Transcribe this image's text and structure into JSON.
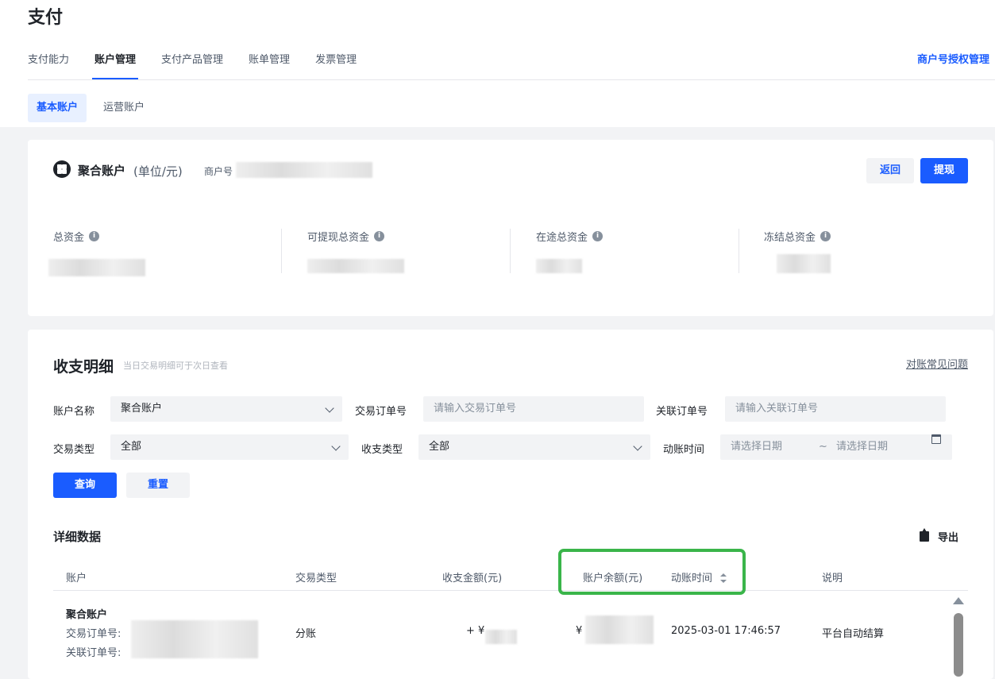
{
  "page_title": "支付",
  "tabs": [
    {
      "label": "支付能力",
      "active": false
    },
    {
      "label": "账户管理",
      "active": true
    },
    {
      "label": "支付产品管理",
      "active": false
    },
    {
      "label": "账单管理",
      "active": false
    },
    {
      "label": "发票管理",
      "active": false
    }
  ],
  "auth_link": "商户号授权管理",
  "subtabs": [
    {
      "label": "基本账户",
      "active": true
    },
    {
      "label": "运营账户",
      "active": false
    }
  ],
  "account": {
    "title": "聚合账户",
    "unit": "(单位/元)",
    "merchant_label": "商户号",
    "back_label": "返回",
    "withdraw_label": "提现"
  },
  "stats": [
    {
      "label": "总资金"
    },
    {
      "label": "可提现总资金"
    },
    {
      "label": "在途总资金"
    },
    {
      "label": "冻结总资金"
    }
  ],
  "ledger": {
    "title": "收支明细",
    "hint": "当日交易明细可于次日查看",
    "faq_link": "对账常见问题"
  },
  "filters": {
    "account_name_label": "账户名称",
    "account_name_value": "聚合账户",
    "order_no_label": "交易订单号",
    "order_no_placeholder": "请输入交易订单号",
    "related_no_label": "关联订单号",
    "related_no_placeholder": "请输入关联订单号",
    "trade_type_label": "交易类型",
    "trade_type_value": "全部",
    "flow_type_label": "收支类型",
    "flow_type_value": "全部",
    "time_label": "动账时间",
    "date_start_placeholder": "请选择日期",
    "date_sep": "~",
    "date_end_placeholder": "请选择日期",
    "query_label": "查询",
    "reset_label": "重置"
  },
  "detail": {
    "title": "详细数据",
    "export_label": "导出",
    "columns": [
      "账户",
      "交易类型",
      "收支金额(元)",
      "账户余额(元)",
      "动账时间",
      "说明"
    ],
    "rows": [
      {
        "account": "聚合账户",
        "order_no_label": "交易订单号:",
        "related_no_label": "关联订单号:",
        "trade_type": "分账",
        "amount_prefix": "+ ¥",
        "balance_prefix": "¥",
        "time": "2025-03-01 17:46:57",
        "remark": "平台自动结算"
      }
    ]
  },
  "colors": {
    "accent": "#1a5cff",
    "highlight": "#3ab54a"
  }
}
